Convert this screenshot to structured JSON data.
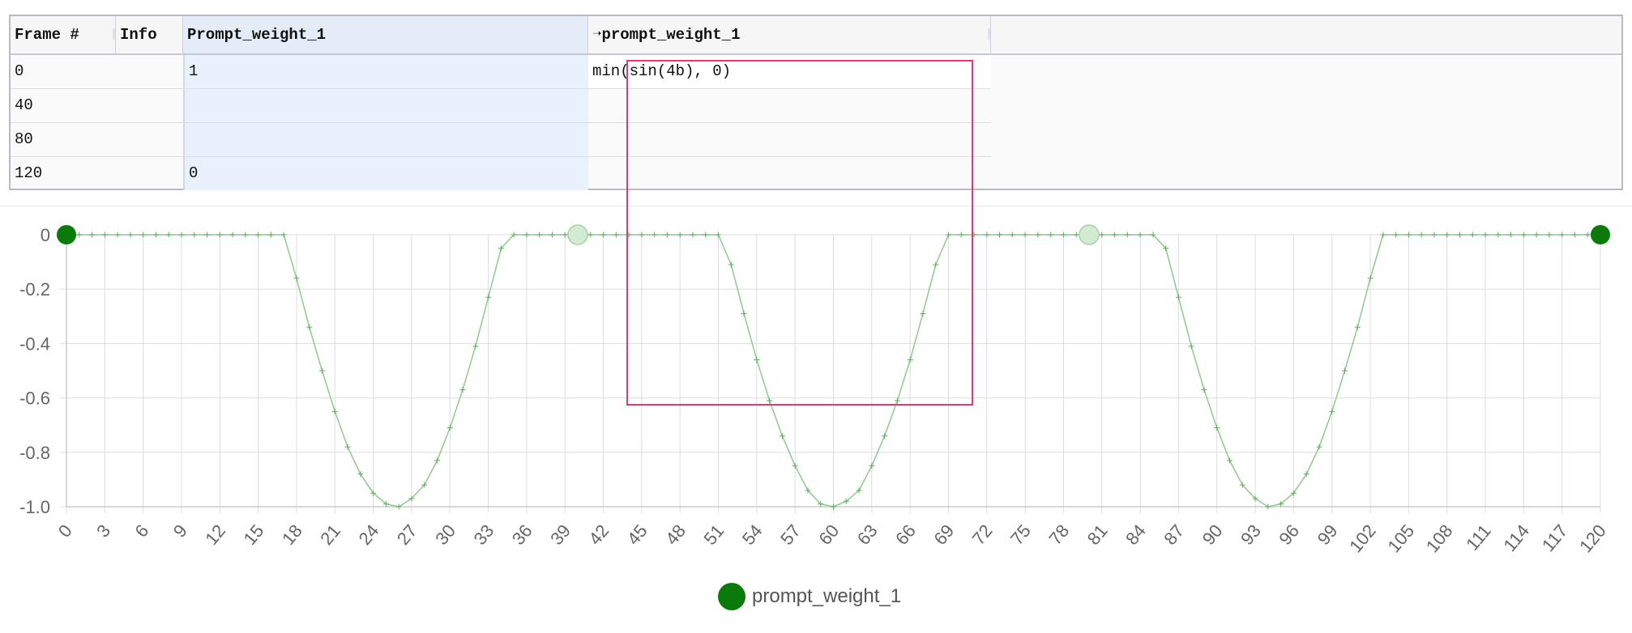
{
  "table": {
    "headers": {
      "frame": "Frame #",
      "info": "Info",
      "prompt_weight": "Prompt_weight_1",
      "formula": "➝prompt_weight_1"
    },
    "rows": [
      {
        "frame": "0",
        "prompt_weight": "1",
        "formula": "min(sin(4b), 0)"
      },
      {
        "frame": "40",
        "prompt_weight": "",
        "formula": ""
      },
      {
        "frame": "80",
        "prompt_weight": "",
        "formula": ""
      },
      {
        "frame": "120",
        "prompt_weight": "0",
        "formula": ""
      }
    ]
  },
  "chart_data": {
    "type": "line",
    "title": "",
    "xlabel": "",
    "ylabel": "",
    "xlim": [
      0,
      120
    ],
    "ylim": [
      -1.0,
      0
    ],
    "x_ticks": [
      "0",
      "3",
      "6",
      "9",
      "12",
      "15",
      "18",
      "21",
      "24",
      "27",
      "30",
      "33",
      "36",
      "39",
      "42",
      "45",
      "48",
      "51",
      "54",
      "57",
      "60",
      "63",
      "66",
      "69",
      "72",
      "75",
      "78",
      "81",
      "84",
      "87",
      "90",
      "93",
      "96",
      "99",
      "102",
      "105",
      "108",
      "111",
      "114",
      "117",
      "120"
    ],
    "y_ticks": [
      "0",
      "-0.2",
      "-0.4",
      "-0.6",
      "-0.8",
      "-1.0"
    ],
    "grid": true,
    "legend": "bottom-center",
    "series": [
      {
        "name": "prompt_weight_1",
        "color": "#0a7a0a",
        "x": [
          0,
          1,
          2,
          3,
          4,
          5,
          6,
          7,
          8,
          9,
          10,
          11,
          12,
          13,
          14,
          15,
          16,
          17,
          18,
          19,
          20,
          21,
          22,
          23,
          24,
          25,
          26,
          27,
          28,
          29,
          30,
          31,
          32,
          33,
          34,
          35,
          36,
          37,
          38,
          39,
          40,
          41,
          42,
          43,
          44,
          45,
          46,
          47,
          48,
          49,
          50,
          51,
          52,
          53,
          54,
          55,
          56,
          57,
          58,
          59,
          60,
          61,
          62,
          63,
          64,
          65,
          66,
          67,
          68,
          69,
          70,
          71,
          72,
          73,
          74,
          75,
          76,
          77,
          78,
          79,
          80,
          81,
          82,
          83,
          84,
          85,
          86,
          87,
          88,
          89,
          90,
          91,
          92,
          93,
          94,
          95,
          96,
          97,
          98,
          99,
          100,
          101,
          102,
          103,
          104,
          105,
          106,
          107,
          108,
          109,
          110,
          111,
          112,
          113,
          114,
          115,
          116,
          117,
          118,
          119,
          120
        ],
        "y": [
          0,
          0,
          0,
          0,
          0,
          0,
          0,
          0,
          0,
          0,
          0,
          0,
          0,
          0,
          0,
          0,
          0,
          0,
          -0.16,
          -0.34,
          -0.5,
          -0.65,
          -0.78,
          -0.88,
          -0.95,
          -0.99,
          -1.0,
          -0.97,
          -0.92,
          -0.83,
          -0.71,
          -0.57,
          -0.41,
          -0.23,
          -0.05,
          0,
          0,
          0,
          0,
          0,
          0,
          0,
          0,
          0,
          0,
          0,
          0,
          0,
          0,
          0,
          0,
          0,
          -0.11,
          -0.29,
          -0.46,
          -0.61,
          -0.74,
          -0.85,
          -0.94,
          -0.99,
          -1.0,
          -0.98,
          -0.94,
          -0.85,
          -0.74,
          -0.61,
          -0.46,
          -0.29,
          -0.11,
          0,
          0,
          0,
          0,
          0,
          0,
          0,
          0,
          0,
          0,
          0,
          0,
          0,
          0,
          0,
          0,
          0,
          -0.05,
          -0.23,
          -0.41,
          -0.57,
          -0.71,
          -0.83,
          -0.92,
          -0.97,
          -1.0,
          -0.99,
          -0.95,
          -0.88,
          -0.78,
          -0.65,
          -0.5,
          -0.34,
          -0.16,
          0,
          0,
          0,
          0,
          0,
          0,
          0,
          0,
          0,
          0,
          0,
          0,
          0,
          0,
          0,
          0,
          0,
          0
        ]
      }
    ],
    "keyframes": [
      {
        "x": 0,
        "y": 0,
        "style": "solid"
      },
      {
        "x": 40,
        "y": 0,
        "style": "hollow"
      },
      {
        "x": 80,
        "y": 0,
        "style": "hollow"
      },
      {
        "x": 120,
        "y": 0,
        "style": "solid"
      }
    ]
  }
}
